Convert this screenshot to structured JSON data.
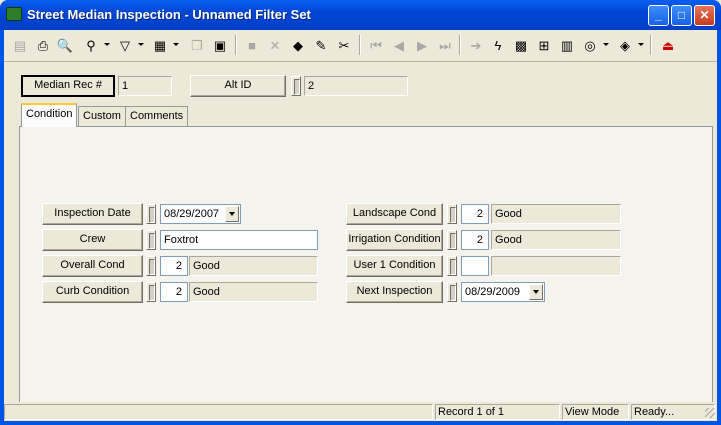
{
  "window": {
    "title": "Street Median Inspection - Unnamed Filter Set",
    "controls": [
      "minimize-icon",
      "maximize-icon",
      "close-icon"
    ]
  },
  "toolbar": {
    "icons": [
      "new-record-icon",
      "print-icon",
      "print-preview-icon",
      "find-icon",
      "filter-icon",
      "report-icon",
      "copy-record-icon",
      "attach-icon",
      "save-icon",
      "delete-icon",
      "stack-icon",
      "edit-pencil-icon",
      "cut-icon",
      "first-record-icon",
      "previous-record-icon",
      "next-record-icon",
      "last-record-icon",
      "go-to-icon",
      "lightning-icon",
      "map-icon",
      "hierarchy-icon",
      "chart-icon",
      "globe-icon",
      "book-icon",
      "exit-icon"
    ]
  },
  "header": {
    "median_rec_label": "Median Rec #",
    "median_rec_value": "1",
    "alt_id_label": "Alt ID",
    "alt_id_value": "2"
  },
  "tabs": [
    {
      "label": "Condition",
      "active": true
    },
    {
      "label": "Custom",
      "active": false
    },
    {
      "label": "Comments",
      "active": false
    }
  ],
  "condition": {
    "left": {
      "inspection_date": {
        "label": "Inspection Date",
        "value": "08/29/2007"
      },
      "crew": {
        "label": "Crew",
        "value": "Foxtrot"
      },
      "overall_cond": {
        "label": "Overall Cond",
        "code": "2",
        "desc": "Good"
      },
      "curb_condition": {
        "label": "Curb Condition",
        "code": "2",
        "desc": "Good"
      }
    },
    "right": {
      "landscape_cond": {
        "label": "Landscape Cond",
        "code": "2",
        "desc": "Good"
      },
      "irrigation_condition": {
        "label": "Irrigation Condition",
        "code": "2",
        "desc": "Good"
      },
      "user1_condition": {
        "label": "User 1 Condition",
        "code": "",
        "desc": ""
      },
      "next_inspection": {
        "label": "Next Inspection",
        "value": "08/29/2009"
      }
    }
  },
  "status_bar": {
    "record": "Record 1 of 1",
    "mode": "View Mode",
    "state": "Ready..."
  }
}
